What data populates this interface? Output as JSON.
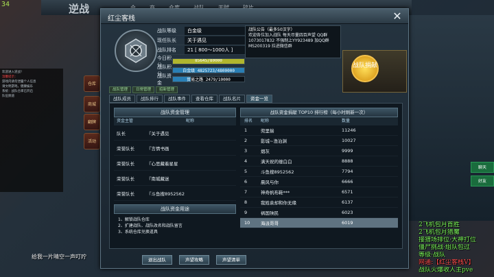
{
  "fps": "34",
  "background": {
    "game_logo": "逆战",
    "nav": [
      "仓",
      "商",
      "仓库",
      "战队",
      "天赋",
      "碎片"
    ],
    "left_chat": [
      {
        "text": "欢迎进入逆战！",
        "red": false
      },
      {
        "text": "温馨提示：",
        "red": true
      },
      {
        "text": "游戏内请勿泄露个人信息",
        "red": false
      },
      {
        "text": "请文明游戏，健康娱乐",
        "red": false
      },
      {
        "text": "系统：战队仓库已开启",
        "red": false
      },
      {
        "text": "队伍频道",
        "red": false
      }
    ],
    "side_icons": [
      "仓库",
      "商城",
      "翻牌",
      "活动"
    ],
    "caption": "给我一片晴空一声叮咛",
    "right_tabs": [
      "聊天",
      "好友"
    ]
  },
  "stream_overlay": [
    {
      "text": "2飞机包月首胜",
      "red": false
    },
    {
      "text": "2飞机包月猎魔",
      "red": false
    },
    {
      "text": "接猎场排位·大神打位",
      "red": false
    },
    {
      "text": "僵尸挑战·组队包过",
      "red": false
    },
    {
      "text": "等级·战队",
      "red": false
    },
    {
      "text": "网通:【红尘客栈V】",
      "red": true
    },
    {
      "text": "战队火爆收人主pve",
      "red": false
    }
  ],
  "dialog": {
    "title": "红尘客栈",
    "close": "✕",
    "info": {
      "level_label": "战队等级",
      "level_value": "白金级",
      "leader_label": "现任队长",
      "leader_value": "关于遇见",
      "rank_label": "战队排名",
      "rank_value": "21 [ 800～1000人 ]"
    },
    "bars": [
      {
        "label": "今日积分",
        "text": "85645/80000",
        "fill": 1.0,
        "color": "#b0b62e"
      },
      {
        "label": "战队积分",
        "text": "白金级  4825723/4800000",
        "fill": 1.0,
        "color": "#2a7fb5"
      },
      {
        "label": "战队资金",
        "text": "贸易之路  2479/10000",
        "fill": 0.25,
        "color": "#2a7fb5"
      }
    ],
    "announcement": {
      "title": "战队公告（最多50汉字）",
      "body": "欢迎各位加入战队 每天尽量四百声望 QQ群 1073017832 不强制上YY923489 加QQ群 MS200319 拉进微信群"
    },
    "donate_button": "战队捐献",
    "subtabs": [
      "战队管理",
      "日常管理",
      "招新管理"
    ],
    "main_tabs": [
      {
        "label": "战队成员",
        "active": false
      },
      {
        "label": "战队排行",
        "active": false
      },
      {
        "label": "战队事件",
        "active": false
      },
      {
        "label": "查看仓库",
        "active": false
      },
      {
        "label": "战队名片",
        "active": false
      },
      {
        "label": "资金一览",
        "active": true
      }
    ],
    "fund_managers": {
      "header": "战队资金管理",
      "col_role": "资金主管",
      "col_name": "昵称",
      "rows": [
        {
          "role": "队长",
          "name": "『关于遇见"
        },
        {
          "role": "荣誉队长",
          "name": "『言情书画"
        },
        {
          "role": "荣誉队长",
          "name": "『心思藏着星星"
        },
        {
          "role": "荣誉队长",
          "name": "『南城藏迷"
        },
        {
          "role": "荣誉队长",
          "name": "『斗鱼搜8952562"
        }
      ]
    },
    "fund_usage": {
      "header": "战队资金用途",
      "items": [
        "1、解锁战队仓库",
        "2、扩建战队、战队改名和战队留言",
        "3、系统仓库兑换道具"
      ]
    },
    "donation_ranking": {
      "header": "战队资金捐献 TOP10 排行榜（每小时刷新一次）",
      "col_rank": "排名",
      "col_name": "昵称",
      "col_amount": "数量",
      "rows": [
        {
          "rank": "1",
          "name": "兜里揣",
          "amount": "11246"
        },
        {
          "rank": "2",
          "name": "影城~渔泊渊",
          "amount": "10027"
        },
        {
          "rank": "3",
          "name": "烟灰",
          "amount": "9999"
        },
        {
          "rank": "4",
          "name": "满天祝的缠白白",
          "amount": "8888"
        },
        {
          "rank": "5",
          "name": "斗鱼搜8952562",
          "amount": "7794"
        },
        {
          "rank": "6",
          "name": "晨风与你",
          "amount": "6666"
        },
        {
          "rank": "7",
          "name": "神奇帆布鞋***",
          "amount": "6571"
        },
        {
          "rank": "8",
          "name": "我姓袁却和你无缘",
          "amount": "6137"
        },
        {
          "rank": "9",
          "name": "祸国殃民",
          "amount": "6023"
        },
        {
          "rank": "10",
          "name": "海派哥哥",
          "amount": "6019"
        }
      ],
      "highlighted_rank": "10"
    },
    "buttons": [
      "退出战队",
      "声望攻略",
      "声望清单"
    ]
  }
}
